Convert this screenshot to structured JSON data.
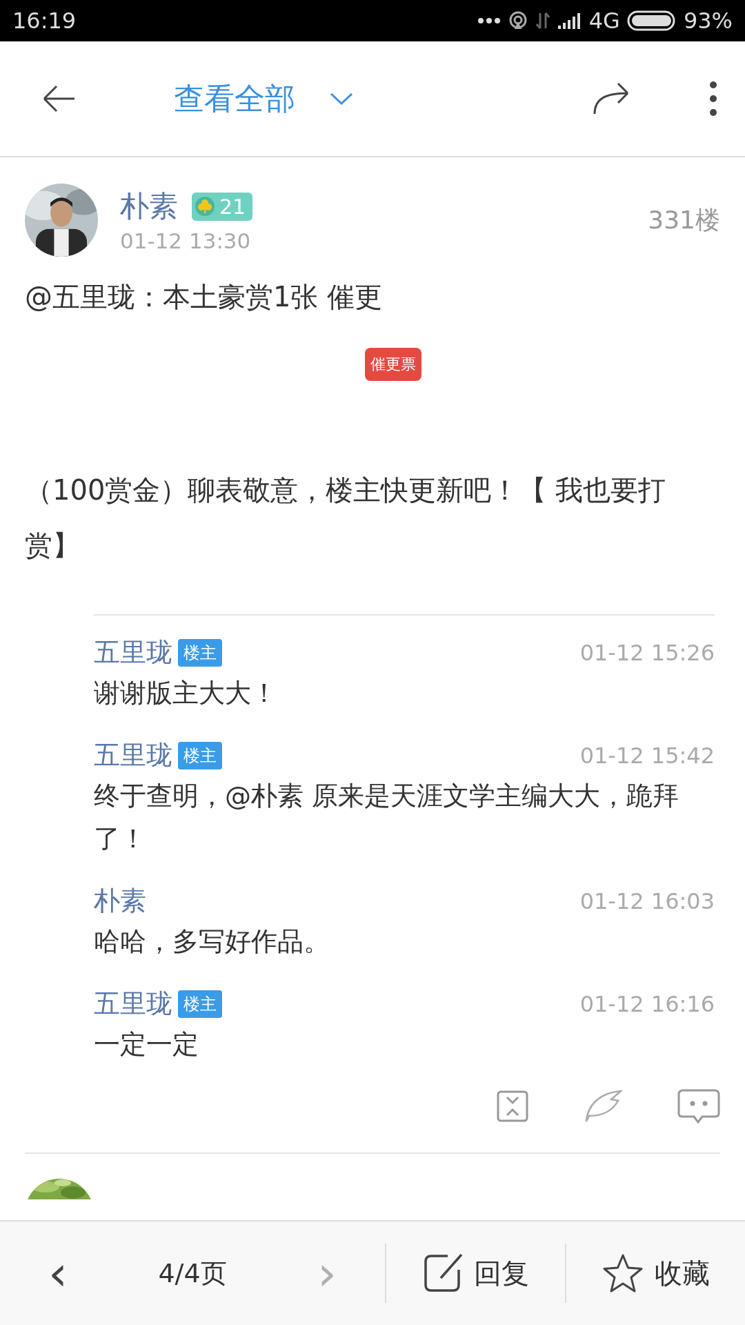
{
  "status_bar": {
    "time": "16:19",
    "network": "4G",
    "battery": "93%"
  },
  "header": {
    "title": "查看全部"
  },
  "post": {
    "author": "朴素",
    "level": "21",
    "time": "01-12 13:30",
    "floor": "331楼",
    "body": "@五里珑：本土豪赏1张 催更",
    "ticket": "催更票",
    "reward_text": "（100赏金）聊表敬意，楼主快更新吧！【 我也要打赏】",
    "replies": [
      {
        "author": "五里珑",
        "is_op": true,
        "op_tag": "楼主",
        "time": "01-12 15:26",
        "text": "谢谢版主大大！"
      },
      {
        "author": "五里珑",
        "is_op": true,
        "op_tag": "楼主",
        "time": "01-12 15:42",
        "text": "终于查明，@朴素 原来是天涯文学主编大大，跪拜了！"
      },
      {
        "author": "朴素",
        "is_op": false,
        "time": "01-12 16:03",
        "text": "哈哈，多写好作品。"
      },
      {
        "author": "五里珑",
        "is_op": true,
        "op_tag": "楼主",
        "time": "01-12 16:16",
        "text": "一定一定"
      }
    ]
  },
  "bottom_bar": {
    "prev": {
      "label": "‹",
      "disabled": false
    },
    "page": "4/4页",
    "next": {
      "label": "›",
      "disabled": true
    },
    "reply": "回复",
    "favorite": "收藏"
  }
}
